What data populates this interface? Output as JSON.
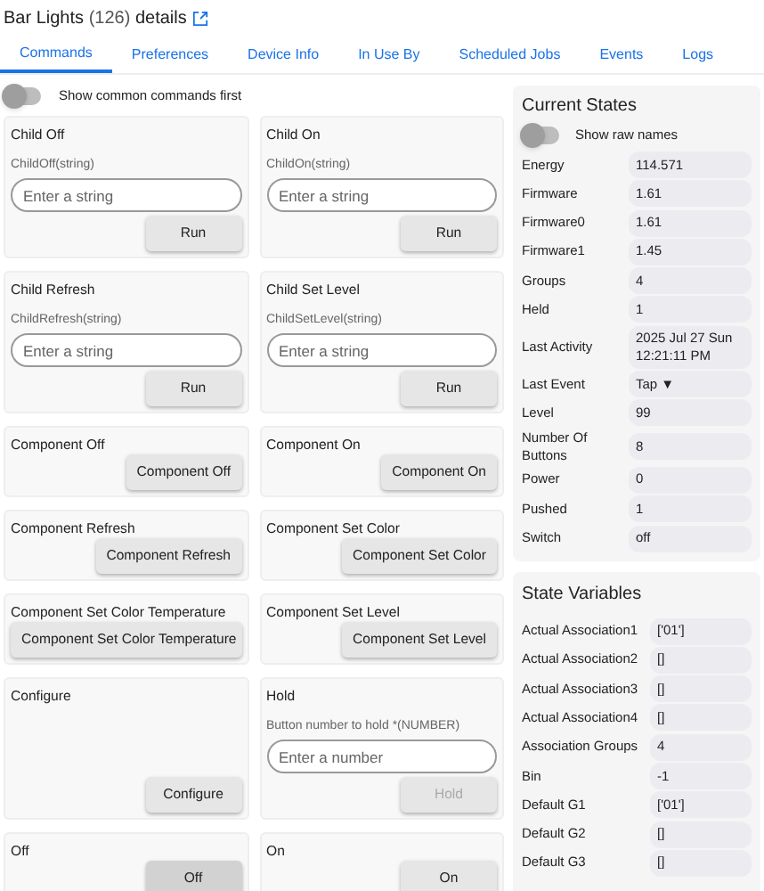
{
  "title": {
    "name": "Bar Lights",
    "count": "(126)",
    "suffix": "details"
  },
  "tabs": [
    {
      "label": "Commands",
      "selected": true
    },
    {
      "label": "Preferences",
      "selected": false
    },
    {
      "label": "Device Info",
      "selected": false
    },
    {
      "label": "In Use By",
      "selected": false
    },
    {
      "label": "Scheduled Jobs",
      "selected": false
    },
    {
      "label": "Events",
      "selected": false
    },
    {
      "label": "Logs",
      "selected": false
    }
  ],
  "common_toggle": {
    "label": "Show common commands first",
    "on": false
  },
  "commands": [
    {
      "kind": "input",
      "name": "Child Off",
      "param": "ChildOff(string)",
      "placeholder": "Enter a string",
      "button": "Run",
      "disabled": false,
      "pressed": false
    },
    {
      "kind": "input",
      "name": "Child On",
      "param": "ChildOn(string)",
      "placeholder": "Enter a string",
      "button": "Run",
      "disabled": false,
      "pressed": false
    },
    {
      "kind": "input",
      "name": "Child Refresh",
      "param": "ChildRefresh(string)",
      "placeholder": "Enter a string",
      "button": "Run",
      "disabled": false,
      "pressed": false
    },
    {
      "kind": "input",
      "name": "Child Set Level",
      "param": "ChildSetLevel(string)",
      "placeholder": "Enter a string",
      "button": "Run",
      "disabled": false,
      "pressed": false
    },
    {
      "kind": "button",
      "name": "Component Off",
      "button": "Component Off",
      "disabled": false,
      "pressed": false
    },
    {
      "kind": "button",
      "name": "Component On",
      "button": "Component On",
      "disabled": false,
      "pressed": false
    },
    {
      "kind": "button",
      "name": "Component Refresh",
      "button": "Component Refresh",
      "disabled": false,
      "pressed": false
    },
    {
      "kind": "button",
      "name": "Component Set Color",
      "button": "Component Set Color",
      "disabled": false,
      "pressed": false
    },
    {
      "kind": "button",
      "name": "Component Set Color Temperature",
      "button": "Component Set Color Temperature",
      "disabled": false,
      "pressed": false
    },
    {
      "kind": "button",
      "name": "Component Set Level",
      "button": "Component Set Level",
      "disabled": false,
      "pressed": false
    },
    {
      "kind": "tall",
      "name": "Configure",
      "button": "Configure",
      "disabled": false,
      "pressed": false
    },
    {
      "kind": "input",
      "name": "Hold",
      "param": "Button number to hold *(NUMBER)",
      "placeholder": "Enter a number",
      "button": "Hold",
      "disabled": true,
      "pressed": false
    },
    {
      "kind": "button",
      "name": "Off",
      "button": "Off",
      "disabled": false,
      "pressed": true
    },
    {
      "kind": "button",
      "name": "On",
      "button": "On",
      "disabled": false,
      "pressed": false
    }
  ],
  "current_states": {
    "title": "Current States",
    "raw_toggle": {
      "label": "Show raw names",
      "on": false
    },
    "rows": [
      {
        "label": "Energy",
        "value": "114.571"
      },
      {
        "label": "Firmware",
        "value": "1.61"
      },
      {
        "label": "Firmware0",
        "value": "1.61"
      },
      {
        "label": "Firmware1",
        "value": "1.45"
      },
      {
        "label": "Groups",
        "value": "4"
      },
      {
        "label": "Held",
        "value": "1"
      },
      {
        "label": "Last Activity",
        "value": "2025 Jul 27 Sun 12:21:11 PM"
      },
      {
        "label": "Last Event",
        "value": "Tap ▼"
      },
      {
        "label": "Level",
        "value": "99"
      },
      {
        "label": "Number Of Buttons",
        "value": "8"
      },
      {
        "label": "Power",
        "value": "0"
      },
      {
        "label": "Pushed",
        "value": "1"
      },
      {
        "label": "Switch",
        "value": "off"
      }
    ]
  },
  "state_variables": {
    "title": "State Variables",
    "rows": [
      {
        "label": "Actual Association1",
        "value": "['01']"
      },
      {
        "label": "Actual Association2",
        "value": "[]"
      },
      {
        "label": "Actual Association3",
        "value": "[]"
      },
      {
        "label": "Actual Association4",
        "value": "[]"
      },
      {
        "label": "Association Groups",
        "value": "4"
      },
      {
        "label": "Bin",
        "value": "-1"
      },
      {
        "label": "Default G1",
        "value": "['01']"
      },
      {
        "label": "Default G2",
        "value": "[]"
      },
      {
        "label": "Default G3",
        "value": "[]"
      }
    ]
  }
}
